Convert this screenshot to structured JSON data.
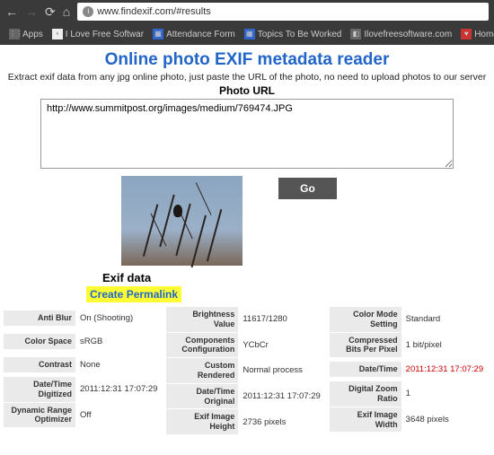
{
  "browser": {
    "url_display": "www.findexif.com/#results",
    "bookmarks": [
      {
        "label": "Apps"
      },
      {
        "label": "I Love Free Softwar"
      },
      {
        "label": "Attendance Form"
      },
      {
        "label": "Topics To Be Worked"
      },
      {
        "label": "Ilovefreesoftware.com"
      },
      {
        "label": "Home Page - I Love F"
      }
    ]
  },
  "page": {
    "title": "Online photo EXIF metadata reader",
    "subtitle": "Extract exif data from any jpg online photo, just paste the URL of the photo, no need to upload photos to our server",
    "photo_url_label": "Photo URL",
    "url_value": "http://www.summitpost.org/images/medium/769474.JPG",
    "go_label": "Go",
    "exif_data_label": "Exif data",
    "permalink_label": "Create Permalink"
  },
  "exif": {
    "col1": [
      {
        "k": "Anti Blur",
        "v": "On (Shooting)"
      },
      {
        "k": "Color Space",
        "v": "sRGB"
      },
      {
        "k": "Contrast",
        "v": "None"
      },
      {
        "k": "Date/Time Digitized",
        "v": "2011:12:31 17:07:29"
      },
      {
        "k": "Dynamic Range Optimizer",
        "v": "Off"
      }
    ],
    "col2": [
      {
        "k": "Brightness Value",
        "v": "11617/1280"
      },
      {
        "k": "Components Configuration",
        "v": "YCbCr"
      },
      {
        "k": "Custom Rendered",
        "v": "Normal process"
      },
      {
        "k": "Date/Time Original",
        "v": "2011:12:31 17:07:29"
      },
      {
        "k": "Exif Image Height",
        "v": "2736 pixels"
      }
    ],
    "col3": [
      {
        "k": "Color Mode Setting",
        "v": "Standard"
      },
      {
        "k": "Compressed Bits Per Pixel",
        "v": "1 bit/pixel"
      },
      {
        "k": "Date/Time",
        "v": "2011:12:31 17:07:29",
        "red": true
      },
      {
        "k": "Digital Zoom Ratio",
        "v": "1"
      },
      {
        "k": "Exif Image Width",
        "v": "3648 pixels"
      }
    ]
  }
}
